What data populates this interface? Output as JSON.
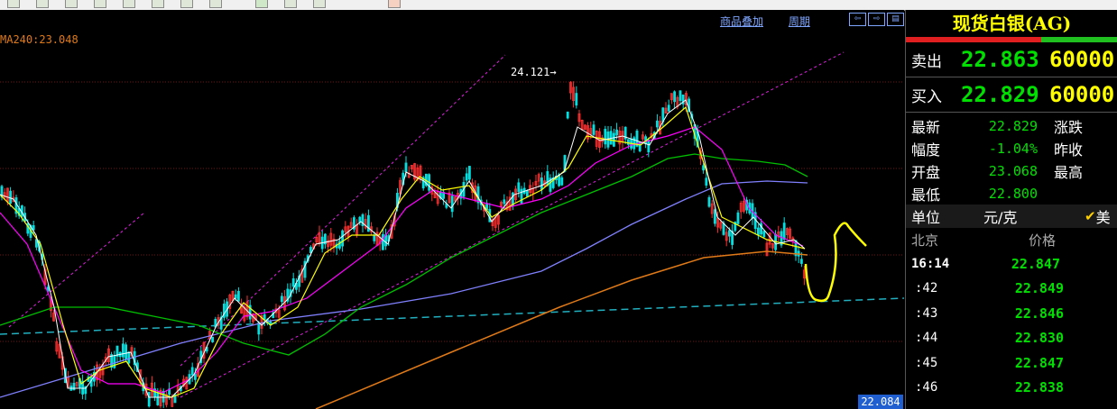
{
  "toolbar": {
    "buttons": [
      "btn1",
      "btn2",
      "btn3",
      "btn4",
      "btn5",
      "btn6",
      "btn7",
      "btn8",
      "btn9",
      "btn10",
      "btn11",
      "btn12"
    ]
  },
  "chart": {
    "links": {
      "overlay": "商品叠加",
      "period": "周期"
    },
    "ma_label": "MA240:23.048",
    "peak_label": "24.121→",
    "price_tag": "22.084"
  },
  "panel": {
    "title": "现货白银(AG)",
    "sell": {
      "label": "卖出",
      "price": "22.863",
      "volume": "60000"
    },
    "buy": {
      "label": "买入",
      "price": "22.829",
      "volume": "60000"
    },
    "stats": [
      {
        "k": "最新",
        "v": "22.829",
        "k2": "涨跌"
      },
      {
        "k": "幅度",
        "v": "-1.04%",
        "k2": "昨收"
      },
      {
        "k": "开盘",
        "v": "23.068",
        "k2": "最高"
      },
      {
        "k": "最低",
        "v": "22.800",
        "k2": ""
      }
    ],
    "unit": {
      "label": "单位",
      "value": "元/克",
      "check": "✔",
      "currency": "美"
    },
    "tick_header": {
      "place": "北京",
      "price": "价格"
    },
    "ticks": [
      {
        "t": "16:14",
        "p": "22.847"
      },
      {
        "t": ":42",
        "p": "22.849"
      },
      {
        "t": ":43",
        "p": "22.846"
      },
      {
        "t": ":44",
        "p": "22.830"
      },
      {
        "t": ":45",
        "p": "22.847"
      },
      {
        "t": ":46",
        "p": "22.838"
      }
    ]
  },
  "colors": {
    "up": "#ff3030",
    "down": "#00e0e0",
    "ma5": "#ffffff",
    "ma10": "#ffff00",
    "ma20": "#ff00ff",
    "ma60": "#00c000",
    "ma120": "#8080ff",
    "ma240": "#e07a18"
  }
}
